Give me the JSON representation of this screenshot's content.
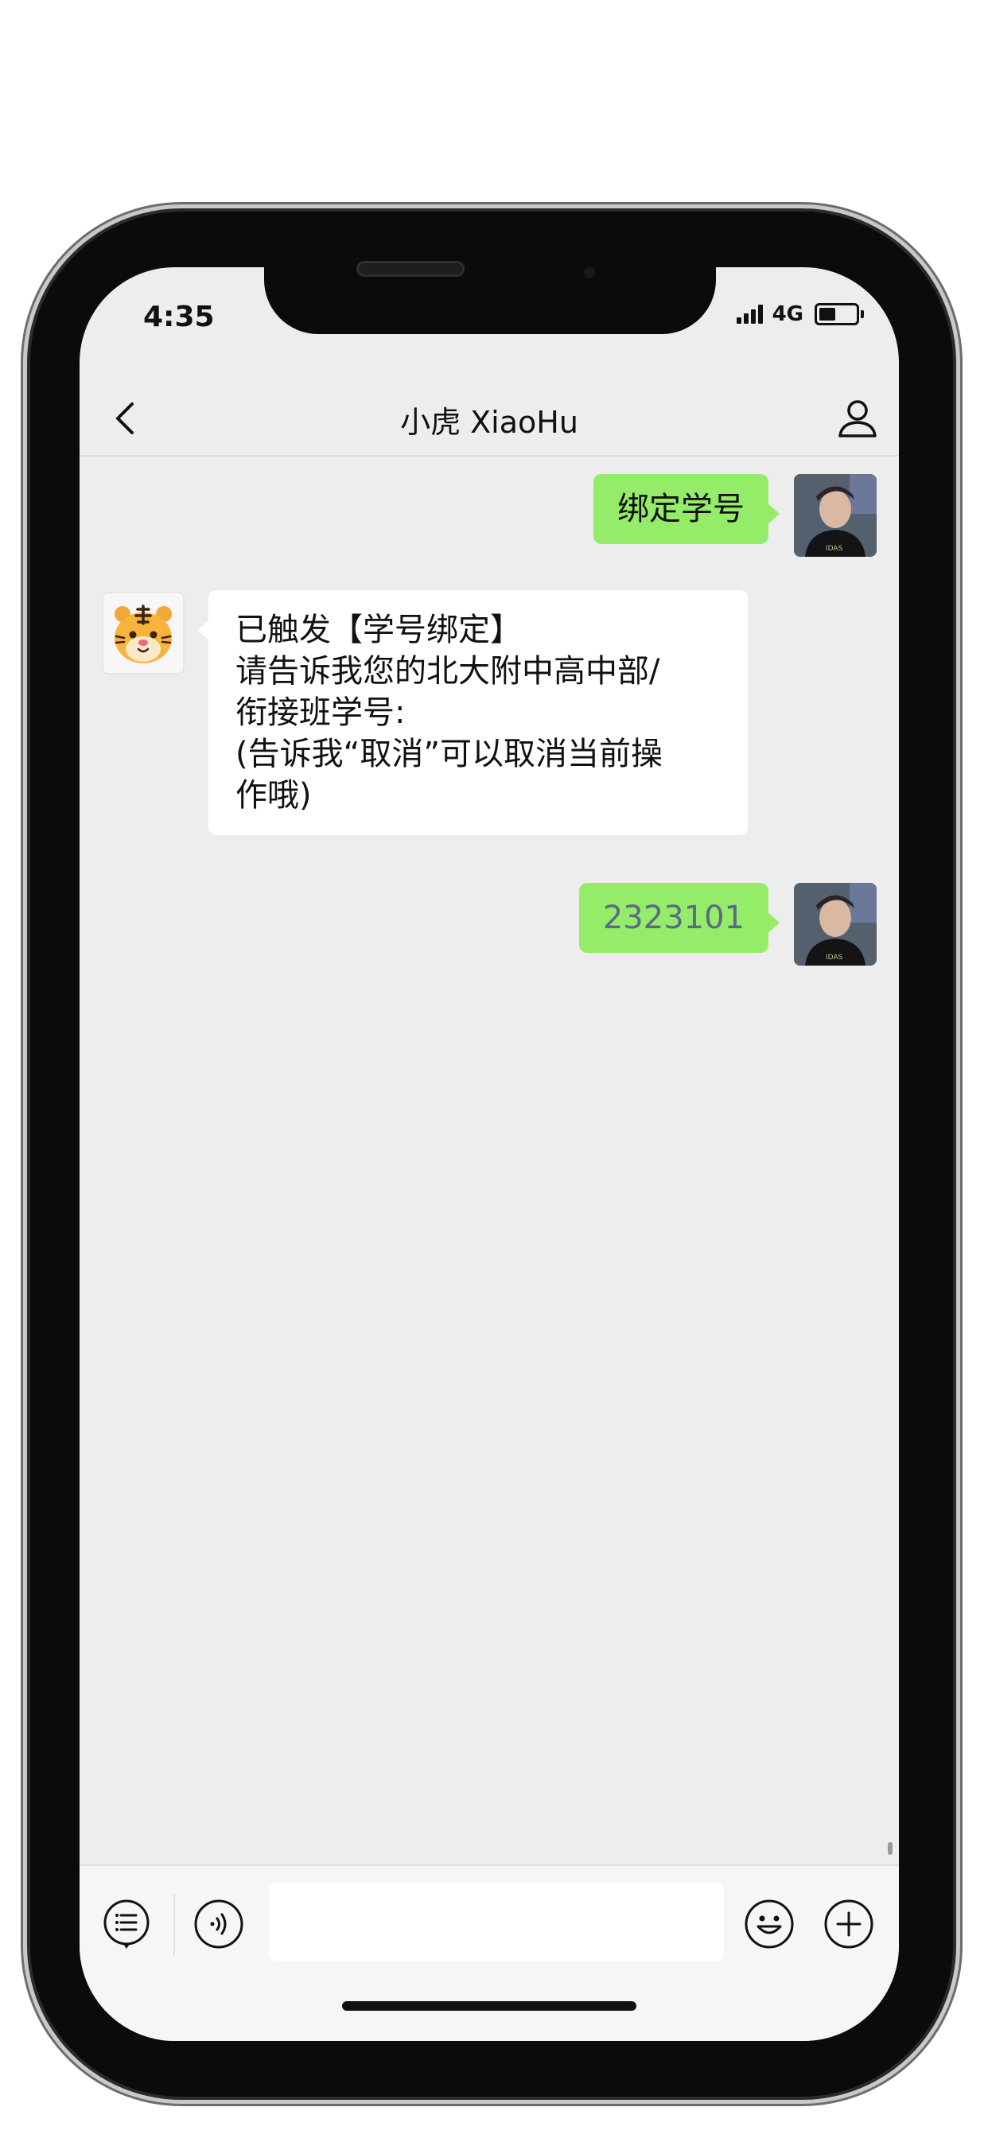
{
  "status_bar": {
    "time": "4:35",
    "network": "4G"
  },
  "header": {
    "title": "小虎 XiaoHu"
  },
  "messages": [
    {
      "from": "user",
      "text": "绑定学号"
    },
    {
      "from": "bot",
      "lines": [
        "已触发【学号绑定】",
        "请告诉我您的北大附中高中部/",
        "衔接班学号:",
        "(告诉我“取消”可以取消当前操",
        "作哦)"
      ]
    },
    {
      "from": "user",
      "text": "2323101"
    }
  ],
  "input": {
    "value": "",
    "placeholder": ""
  },
  "colors": {
    "outgoing_bubble": "#95ec69",
    "incoming_bubble": "#ffffff",
    "chat_background": "#ededed"
  },
  "icons": [
    "back-chevron-icon",
    "profile-icon",
    "list-icon",
    "voice-icon",
    "emoji-icon",
    "plus-icon"
  ]
}
